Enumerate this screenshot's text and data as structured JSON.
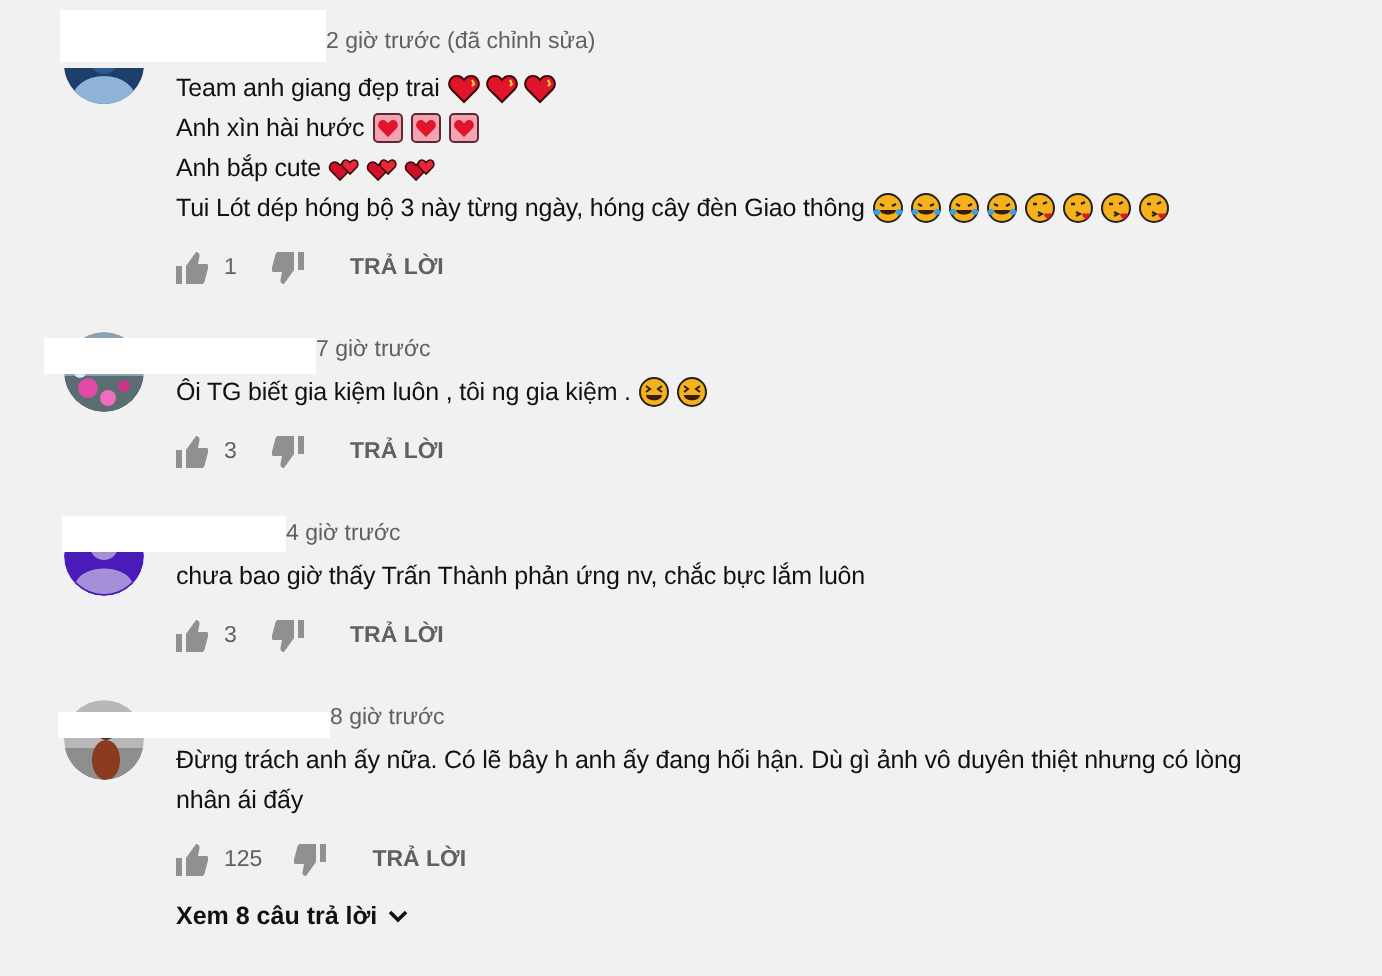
{
  "comments": [
    {
      "time": "2 giờ trước (đã chỉnh sửa)",
      "lines": [
        {
          "text": "Team anh giang đẹp trai"
        },
        {
          "text": "Anh xìn hài hước"
        },
        {
          "text": "Anh bắp cute"
        },
        {
          "text": "Tui Lót dép hóng bộ 3 này từng ngày, hóng cây đèn Giao thông"
        }
      ],
      "likes": "1",
      "reply": "TRẢ LỜI"
    },
    {
      "time": "7 giờ trước",
      "lines": [
        {
          "text": "Ôi TG biết gia kiệm luôn , tôi ng gia kiệm ."
        }
      ],
      "likes": "3",
      "reply": "TRẢ LỜI"
    },
    {
      "avatar": {
        "kind": "default"
      },
      "time": "4 giờ trước",
      "lines": [
        {
          "text": "chưa bao giờ thấy Trấn Thành phản ứng nv, chắc bực lắm luôn"
        }
      ],
      "likes": "3",
      "reply": "TRẢ LỜI"
    },
    {
      "time": "8 giờ trước",
      "lines": [
        {
          "text": "Đừng trách anh ấy nữa. Có lẽ bây h anh ấy đang hối hận. Dù gì ảnh vô duyên thiệt nhưng có lòng nhân ái đấy"
        }
      ],
      "likes": "125",
      "reply": "TRẢ LỜI",
      "replies_link": "Xem 8 câu trả lời"
    }
  ]
}
